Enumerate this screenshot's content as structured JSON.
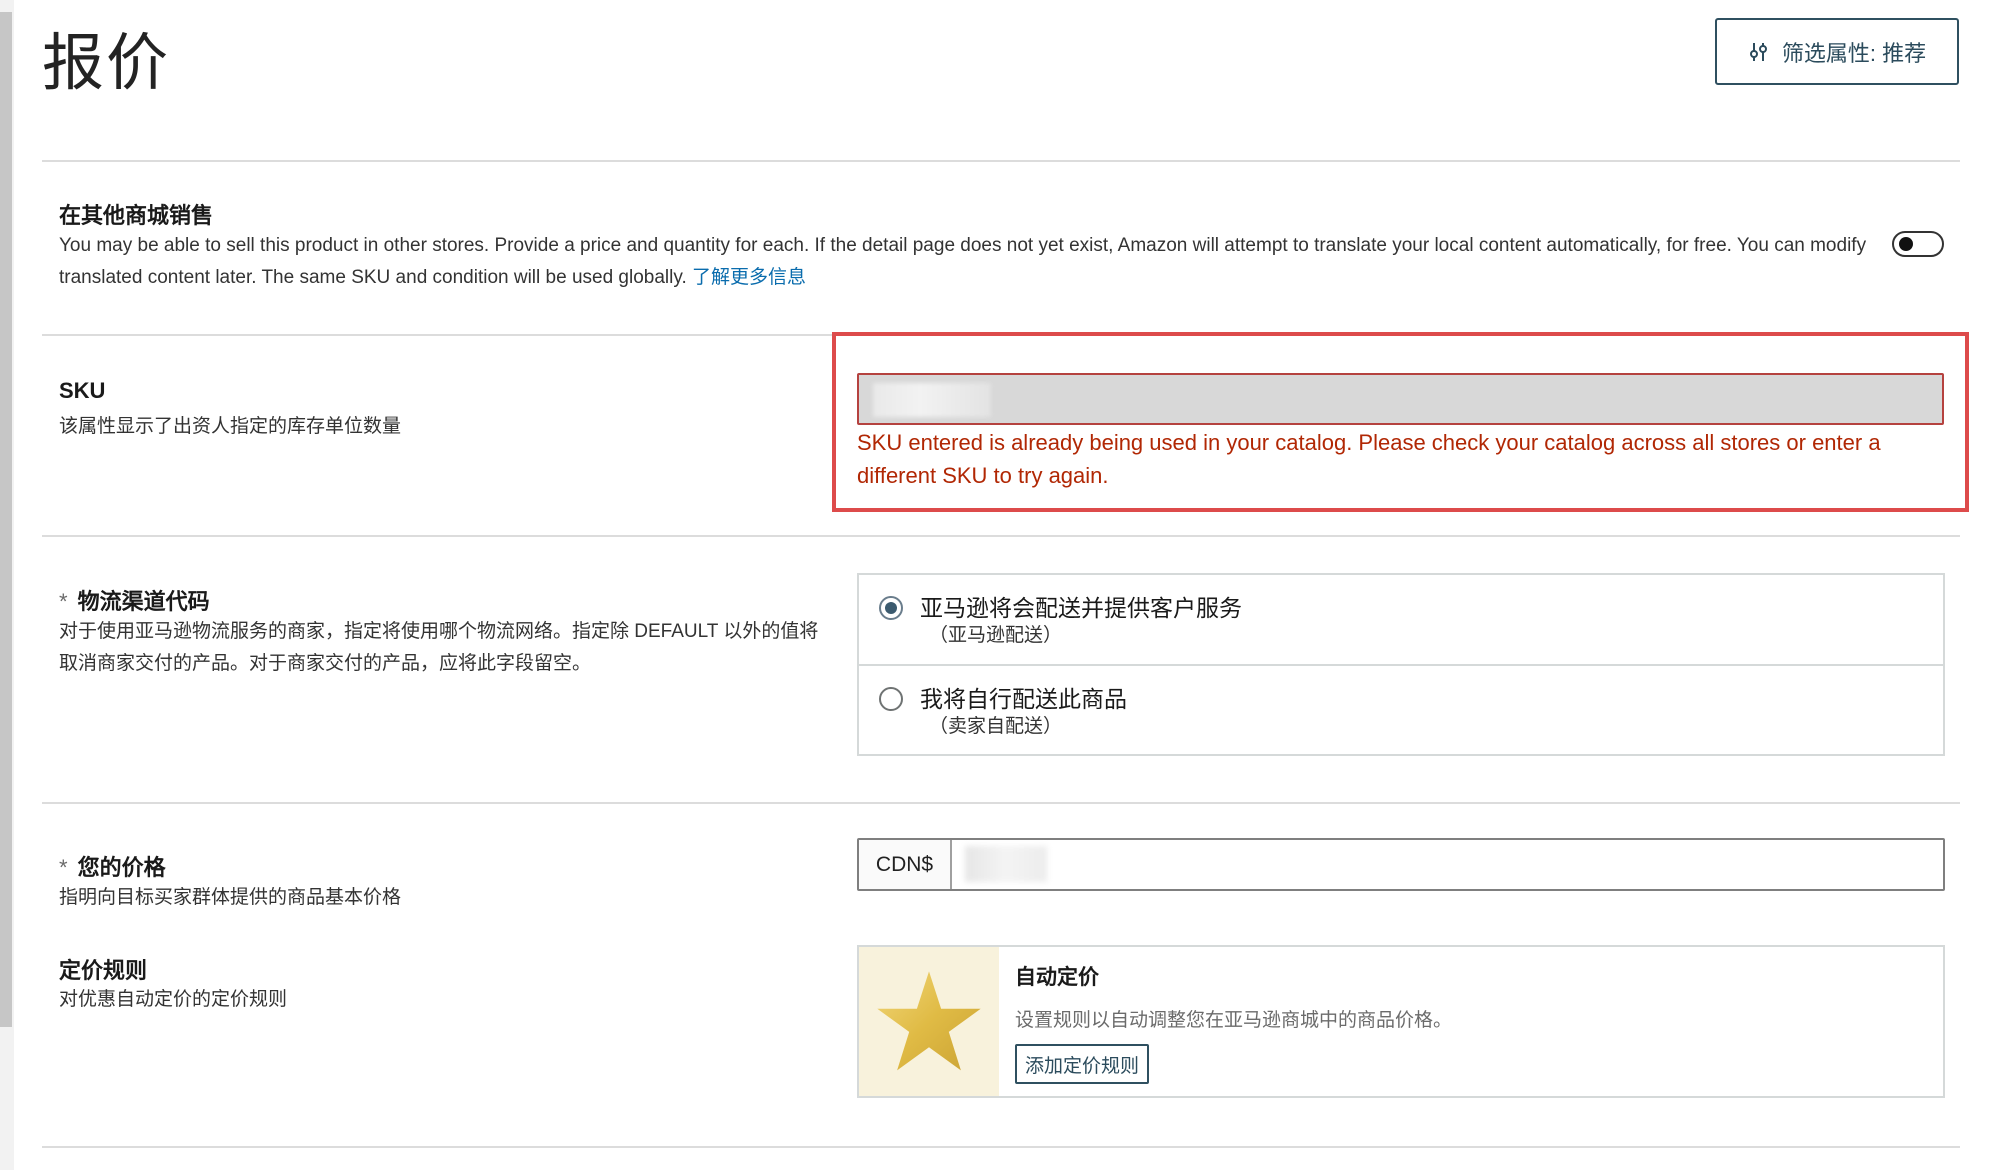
{
  "page": {
    "title": "报价"
  },
  "filter_button": {
    "label": "筛选属性: 推荐",
    "icon": "sliders-icon"
  },
  "other_stores": {
    "title": "在其他商城销售",
    "description": "You may be able to sell this product in other stores. Provide a price and quantity for each. If the detail page does not yet exist, Amazon will attempt to translate your local content automatically, for free. You can modify translated content later. The same SKU and condition will be used globally.",
    "link": "了解更多信息",
    "toggle_on": false
  },
  "sku": {
    "title": "SKU",
    "description": "该属性显示了出资人指定的库存单位数量",
    "error": "SKU entered is already being used in your catalog. Please check your catalog across all stores or enter a different SKU to try again."
  },
  "fulfillment": {
    "required_mark": "*",
    "title": "物流渠道代码",
    "description": "对于使用亚马逊物流服务的商家，指定将使用哪个物流网络。指定除 DEFAULT 以外的值将取消商家交付的产品。对于商家交付的产品，应将此字段留空。",
    "options": [
      {
        "label": "亚马逊将会配送并提供客户服务",
        "sub": "（亚马逊配送）",
        "selected": true
      },
      {
        "label": "我将自行配送此商品",
        "sub": "（卖家自配送）",
        "selected": false
      }
    ]
  },
  "price": {
    "required_mark": "*",
    "title": "您的价格",
    "description": "指明向目标买家群体提供的商品基本价格",
    "currency_prefix": "CDN$"
  },
  "pricing_rules": {
    "title": "定价规则",
    "description": "对优惠自动定价的定价规则",
    "card_title": "自动定价",
    "card_desc": "设置规则以自动调整您在亚马逊商城中的商品价格。",
    "button_label": "添加定价规则",
    "icon": "star-icon"
  },
  "colors": {
    "error": "#b12704",
    "error_frame": "#dd4b4b",
    "link": "#0a6cad",
    "accent": "#2f5060"
  }
}
